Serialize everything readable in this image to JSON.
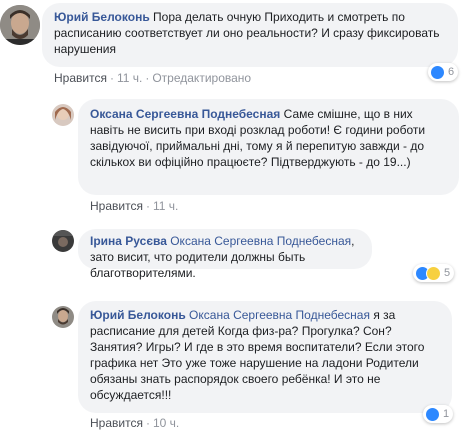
{
  "comments": [
    {
      "author": "Юрий Белоконь",
      "text": "Пора делать очную Приходить и смотреть по расписанию соответствует ли оно реальности? И сразу фиксировать нарушения",
      "like_label": "Нравится",
      "time": "11 ч.",
      "edited": "Отредактировано",
      "reaction_count": "6"
    },
    {
      "author": "Оксана Сергеевна Поднебесная",
      "text": "Саме смішне, що в них навіть не висить при вході розклад роботи! Є години роботи завідуючої, приймальні дні, тому я й перепитую завжди - до скількох ви офіційно працюєте? Підтверджують - до 19...)",
      "like_label": "Нравится",
      "time": "11 ч."
    },
    {
      "author": "Ірина Русєва",
      "mention": "Оксана Сергеевна Поднебесная",
      "text": ", зато висит, что родители должны быть благотворителями.",
      "reaction_count": "5"
    },
    {
      "author": "Юрий Белоконь",
      "mention": "Оксана Сергеевна Поднебесная",
      "text": " я за расписание для детей Когда физ-ра? Прогулка? Сон? Занятия? Игры? И где в это время воспитатели? Если этого графика нет Это уже тоже нарушение на ладони Родители обязаны знать распорядок своего ребёнка! И это не обсуждается!!!",
      "like_label": "Нравится",
      "time": "10 ч.",
      "reaction_count": "1"
    }
  ],
  "colors": {
    "author": "#385898",
    "bubble": "#f2f3f5",
    "like": "#2d88ff",
    "haha": "#f7d03f"
  }
}
